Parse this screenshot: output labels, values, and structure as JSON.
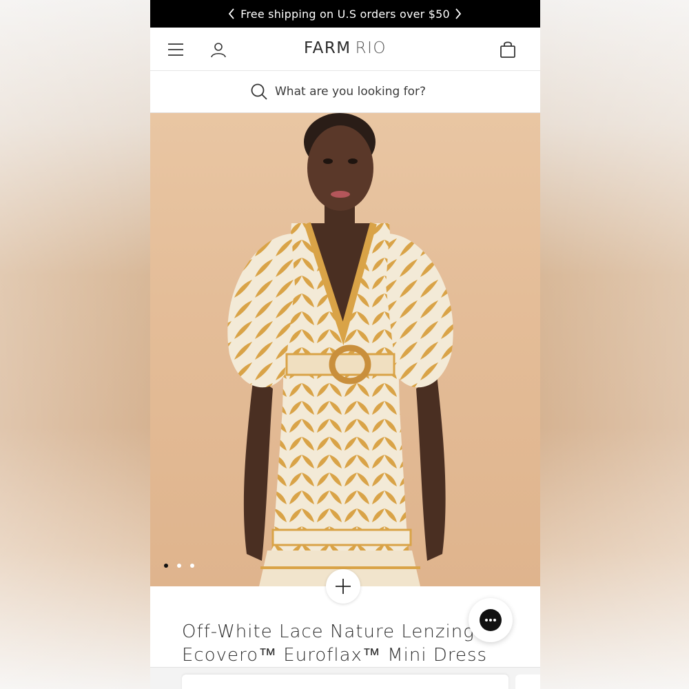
{
  "announcement": {
    "message": "Free shipping on U.S orders over $50"
  },
  "header": {
    "logo_primary": "FARM",
    "logo_secondary": "RIO"
  },
  "search": {
    "placeholder": "What are you looking for?"
  },
  "product": {
    "title_line1": "Off-White Lace Nature Lenzing",
    "title_line2": "Ecovero™ Euroflax™ Mini Dress",
    "image_count": 3,
    "active_image": 1
  },
  "colors": {
    "announcement_bg": "#000000",
    "hero_bg": "#e4bd98",
    "dress_gold": "#d9a347",
    "dress_cream": "#f3ead7"
  },
  "icons": {
    "prev": "chevron-left-icon",
    "next": "chevron-right-icon",
    "menu": "hamburger-menu-icon",
    "account": "user-icon",
    "bag": "shopping-bag-icon",
    "search": "search-icon",
    "expand": "plus-icon",
    "chat": "chat-bubble-icon"
  }
}
